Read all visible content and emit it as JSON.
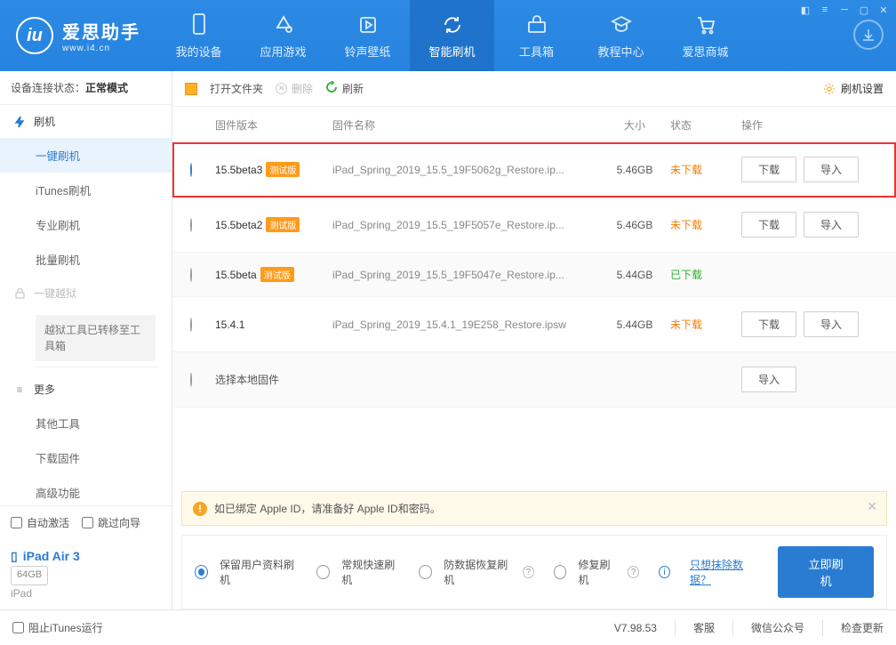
{
  "titlebar": {
    "app_cn": "爱思助手",
    "app_en": "www.i4.cn",
    "nav": [
      {
        "label": "我的设备"
      },
      {
        "label": "应用游戏"
      },
      {
        "label": "铃声壁纸"
      },
      {
        "label": "智能刷机"
      },
      {
        "label": "工具箱"
      },
      {
        "label": "教程中心"
      },
      {
        "label": "爱思商城"
      }
    ]
  },
  "sidebar": {
    "conn_label": "设备连接状态：",
    "conn_value": "正常模式",
    "groups": [
      {
        "label": "刷机",
        "items": [
          {
            "label": "一键刷机",
            "active": true
          },
          {
            "label": "iTunes刷机"
          },
          {
            "label": "专业刷机"
          },
          {
            "label": "批量刷机"
          }
        ]
      },
      {
        "label": "一键越狱",
        "disabled": true,
        "movebox": "越狱工具已转移至工具箱"
      },
      {
        "label": "更多",
        "items": [
          {
            "label": "其他工具"
          },
          {
            "label": "下载固件"
          },
          {
            "label": "高级功能"
          }
        ]
      }
    ],
    "auto_activate": "自动激活",
    "skip_guide": "跳过向导",
    "device": {
      "name": "iPad Air 3",
      "capacity": "64GB",
      "type": "iPad"
    }
  },
  "toolbar": {
    "open": "打开文件夹",
    "del": "删除",
    "refresh": "刷新",
    "settings": "刷机设置"
  },
  "table": {
    "head": {
      "ver": "固件版本",
      "name": "固件名称",
      "size": "大小",
      "status": "状态",
      "act": "操作"
    },
    "rows": [
      {
        "ver": "15.5beta3",
        "beta": "测试版",
        "name": "iPad_Spring_2019_15.5_19F5062g_Restore.ip...",
        "size": "5.46GB",
        "status": "未下载",
        "actions": [
          "下载",
          "导入"
        ],
        "sel": true,
        "hl": true
      },
      {
        "ver": "15.5beta2",
        "beta": "测试版",
        "name": "iPad_Spring_2019_15.5_19F5057e_Restore.ip...",
        "size": "5.46GB",
        "status": "未下载",
        "actions": [
          "下载",
          "导入"
        ]
      },
      {
        "ver": "15.5beta",
        "beta": "测试版",
        "name": "iPad_Spring_2019_15.5_19F5047e_Restore.ip...",
        "size": "5.44GB",
        "status": "已下载",
        "alt": true
      },
      {
        "ver": "15.4.1",
        "name": "iPad_Spring_2019_15.4.1_19E258_Restore.ipsw",
        "size": "5.44GB",
        "status": "未下载",
        "actions": [
          "下载",
          "导入"
        ]
      },
      {
        "local": "选择本地固件",
        "actions": [
          "导入"
        ],
        "alt": true
      }
    ]
  },
  "alert": "如已绑定 Apple ID，请准备好 Apple ID和密码。",
  "actbar": {
    "opts": [
      "保留用户资料刷机",
      "常规快速刷机",
      "防数据恢复刷机",
      "修复刷机"
    ],
    "erase": "只想抹除数据？",
    "flash": "立即刷机"
  },
  "status": {
    "block": "阻止iTunes运行",
    "version": "V7.98.53",
    "links": [
      "客服",
      "微信公众号",
      "检查更新"
    ]
  }
}
